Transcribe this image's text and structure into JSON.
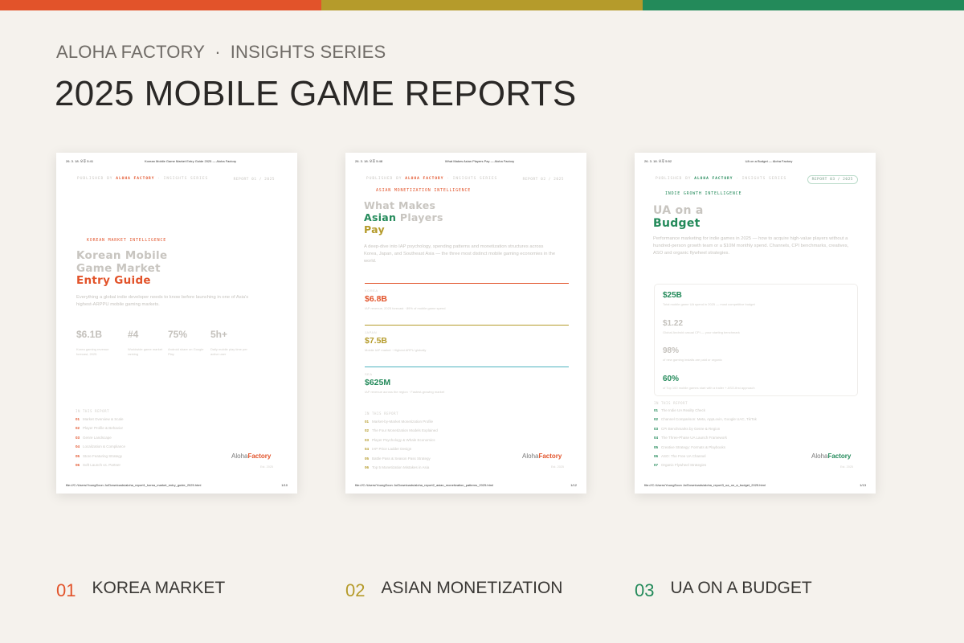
{
  "colors": {
    "orange": "#e2532a",
    "olive": "#b59b2b",
    "green": "#238a5a",
    "teal": "#4fb3bf"
  },
  "header": {
    "brand": "ALOHA FACTORY",
    "separator": "·",
    "series": "INSIGHTS SERIES",
    "title": "2025 MOBILE GAME REPORTS"
  },
  "cards": [
    {
      "print_date": "26. 3. 18. 오후 5:41",
      "print_title": "Korean Mobile Game Market Entry Guide 2025 — Aloha Factory",
      "published_prefix": "PUBLISHED BY",
      "published_brand": "ALOHA FACTORY",
      "published_suffix": "· INSIGHTS SERIES",
      "report_no": "REPORT 01 / 2025",
      "tag": "KOREAN MARKET INTELLIGENCE",
      "title_lines": [
        "Korean Mobile",
        "Game Market",
        "Entry Guide"
      ],
      "desc": "Everything a global indie developer needs to know before launching in one of Asia's highest-ARPPU mobile gaming markets.",
      "stats": [
        {
          "value": "$6.1B",
          "desc": "Korea gaming revenue forecast, 2025"
        },
        {
          "value": "#4",
          "desc": "Worldwide game market ranking"
        },
        {
          "value": "75%",
          "desc": "Android share on Google Play"
        },
        {
          "value": "5h+",
          "desc": "Daily mobile play time per active user"
        }
      ],
      "toc_title": "IN THIS REPORT",
      "toc": [
        {
          "n": "01",
          "label": "Market Overview & Scale"
        },
        {
          "n": "02",
          "label": "Player Profile & Behavior"
        },
        {
          "n": "03",
          "label": "Genre Landscape"
        },
        {
          "n": "04",
          "label": "Localization & Compliance"
        },
        {
          "n": "05",
          "label": "Store Featuring Strategy"
        },
        {
          "n": "06",
          "label": "Soft Launch vs. Partner"
        }
      ],
      "logo_a": "Aloha",
      "logo_b": "Factory",
      "logo_year": "Est. 2025",
      "file_path": "file:///C:/Users/YoungSoon Jo/Downloads/aloha_report1_korea_market_entry_guide_2025.html",
      "page": "1/10"
    },
    {
      "print_date": "26. 3. 18. 오후 5:48",
      "print_title": "What Makes Asian Players Pay — Aloha Factory",
      "published_prefix": "PUBLISHED BY",
      "published_brand": "ALOHA FACTORY",
      "published_suffix": "· INSIGHTS SERIES",
      "report_no": "REPORT 02 / 2025",
      "tag": "ASIAN MONETIZATION INTELLIGENCE",
      "title_lines": [
        "What Makes",
        "Asian",
        "Players",
        "Pay"
      ],
      "desc": "A deep-dive into IAP psychology, spending patterns and monetization structures across Korea, Japan, and Southeast Asia — the three most distinct mobile gaming economies in the world.",
      "markets": [
        {
          "label": "KOREA",
          "value": "$6.8B",
          "desc": "IAP revenue, 2025 forecast · 89% of mobile game spend"
        },
        {
          "label": "JAPAN",
          "value": "$7.5B",
          "desc": "Mobile IAP market · Highest ARPU globally"
        },
        {
          "label": "SEA",
          "value": "$625M",
          "desc": "IAP revenue across the region · Fastest-growing market"
        }
      ],
      "toc_title": "IN THIS REPORT",
      "toc": [
        {
          "n": "01",
          "label": "Market-by-Market Monetization Profile"
        },
        {
          "n": "02",
          "label": "The Four Monetization Models Explained"
        },
        {
          "n": "03",
          "label": "Player Psychology & Whale Economics"
        },
        {
          "n": "04",
          "label": "IAP Price Ladder Design"
        },
        {
          "n": "05",
          "label": "Battle Pass & Season Pass Strategy"
        },
        {
          "n": "06",
          "label": "Top 5 Monetization Mistakes in Asia"
        }
      ],
      "logo_a": "Aloha",
      "logo_b": "Factory",
      "logo_year": "Est. 2025",
      "file_path": "file:///C:/Users/YoungSoon Jo/Downloads/aloha_report2_asian_monetization_patterns_2025.html",
      "page": "1/12"
    },
    {
      "print_date": "26. 3. 18. 오후 5:52",
      "print_title": "UA on a Budget — Aloha Factory",
      "published_prefix": "PUBLISHED BY",
      "published_brand": "ALOHA FACTORY",
      "published_suffix": "· INSIGHTS SERIES",
      "report_no": "REPORT 03 / 2025",
      "tag": "INDIE GROWTH INTELLIGENCE",
      "title_lines": [
        "UA on a",
        "Budget"
      ],
      "desc": "Performance marketing for indie games in 2025 — how to acquire high-value players without a hundred-person growth team or a $10M monthly spend. Channels, CPI benchmarks, creatives, ASO and organic flywheel strategies.",
      "budget": [
        {
          "value": "$25B",
          "desc": "Total mobile game UA spend in 2025 — most competitive budget"
        },
        {
          "value": "$1.22",
          "desc": "Global Android casual CPI — your starting benchmark"
        },
        {
          "value": "98%",
          "desc": "of new gaming installs are paid or organic"
        },
        {
          "value": "60%",
          "desc": "of Top 100 mobile games start with a trailer + ASO-first approach"
        }
      ],
      "toc_title": "IN THIS REPORT",
      "toc": [
        {
          "n": "01",
          "label": "The Indie UA Reality Check"
        },
        {
          "n": "02",
          "label": "Channel Comparison: Meta, AppLovin, Google UAC, TikTok"
        },
        {
          "n": "03",
          "label": "CPI Benchmarks by Genre & Region"
        },
        {
          "n": "04",
          "label": "The Three-Phase UA Launch Framework"
        },
        {
          "n": "05",
          "label": "Creative Strategy: Formats & Playbooks"
        },
        {
          "n": "06",
          "label": "ASO: The Free UA Channel"
        },
        {
          "n": "07",
          "label": "Organic Flywheel Strategies"
        }
      ],
      "logo_a": "Aloha",
      "logo_b": "Factory",
      "logo_year": "Est. 2025",
      "file_path": "file:///C:/Users/YoungSoon Jo/Downloads/aloha_report3_ua_on_a_budget_2025.html",
      "page": "1/13"
    }
  ],
  "bottom": [
    {
      "num": "01",
      "label": "KOREA MARKET"
    },
    {
      "num": "02",
      "label": "ASIAN MONETIZATION"
    },
    {
      "num": "03",
      "label": "UA ON A BUDGET"
    }
  ]
}
